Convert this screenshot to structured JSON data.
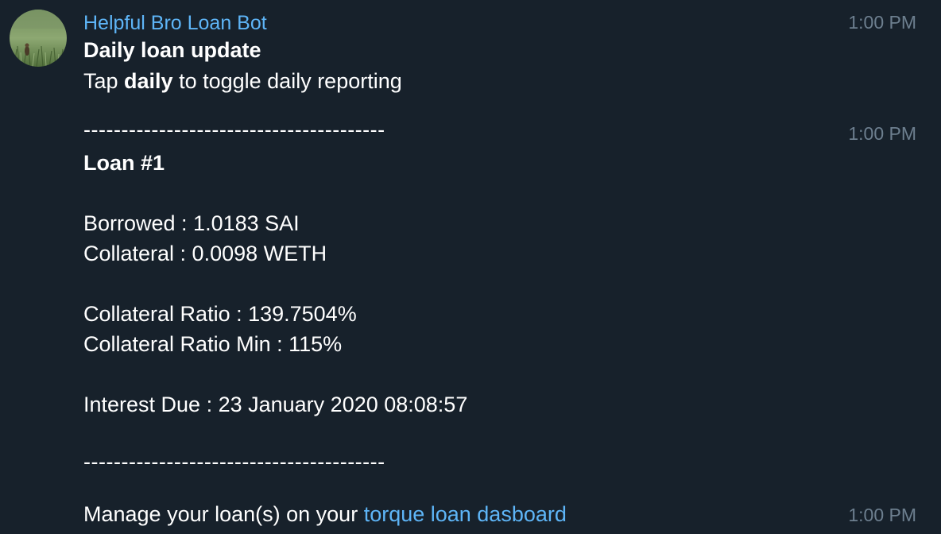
{
  "message": {
    "sender_name": "Helpful Bro Loan Bot",
    "avatar_icon": "grass-field-avatar",
    "accent_color": "#5eb5f7",
    "background_color": "#17212b",
    "time_color": "#6d7f8f"
  },
  "bubble1": {
    "time": "1:00 PM",
    "title": "Daily loan update",
    "hint_prefix": "Tap ",
    "hint_command": "daily",
    "hint_suffix": " to toggle daily reporting"
  },
  "bubble2": {
    "time": "1:00 PM",
    "separator": "----------------------------------------",
    "loan_title": "Loan #1",
    "borrowed": "Borrowed : 1.0183 SAI",
    "collateral": "Collateral : 0.0098 WETH",
    "collateral_ratio": "Collateral Ratio : 139.7504%",
    "collateral_ratio_min": "Collateral Ratio Min : 115%",
    "interest_due": "Interest Due : 23 January 2020 08:08:57",
    "separator_bottom": "----------------------------------------"
  },
  "bubble3": {
    "time": "1:00 PM",
    "manage_prefix": "Manage your loan(s) on your ",
    "dashboard_link": "torque loan dasboard"
  }
}
